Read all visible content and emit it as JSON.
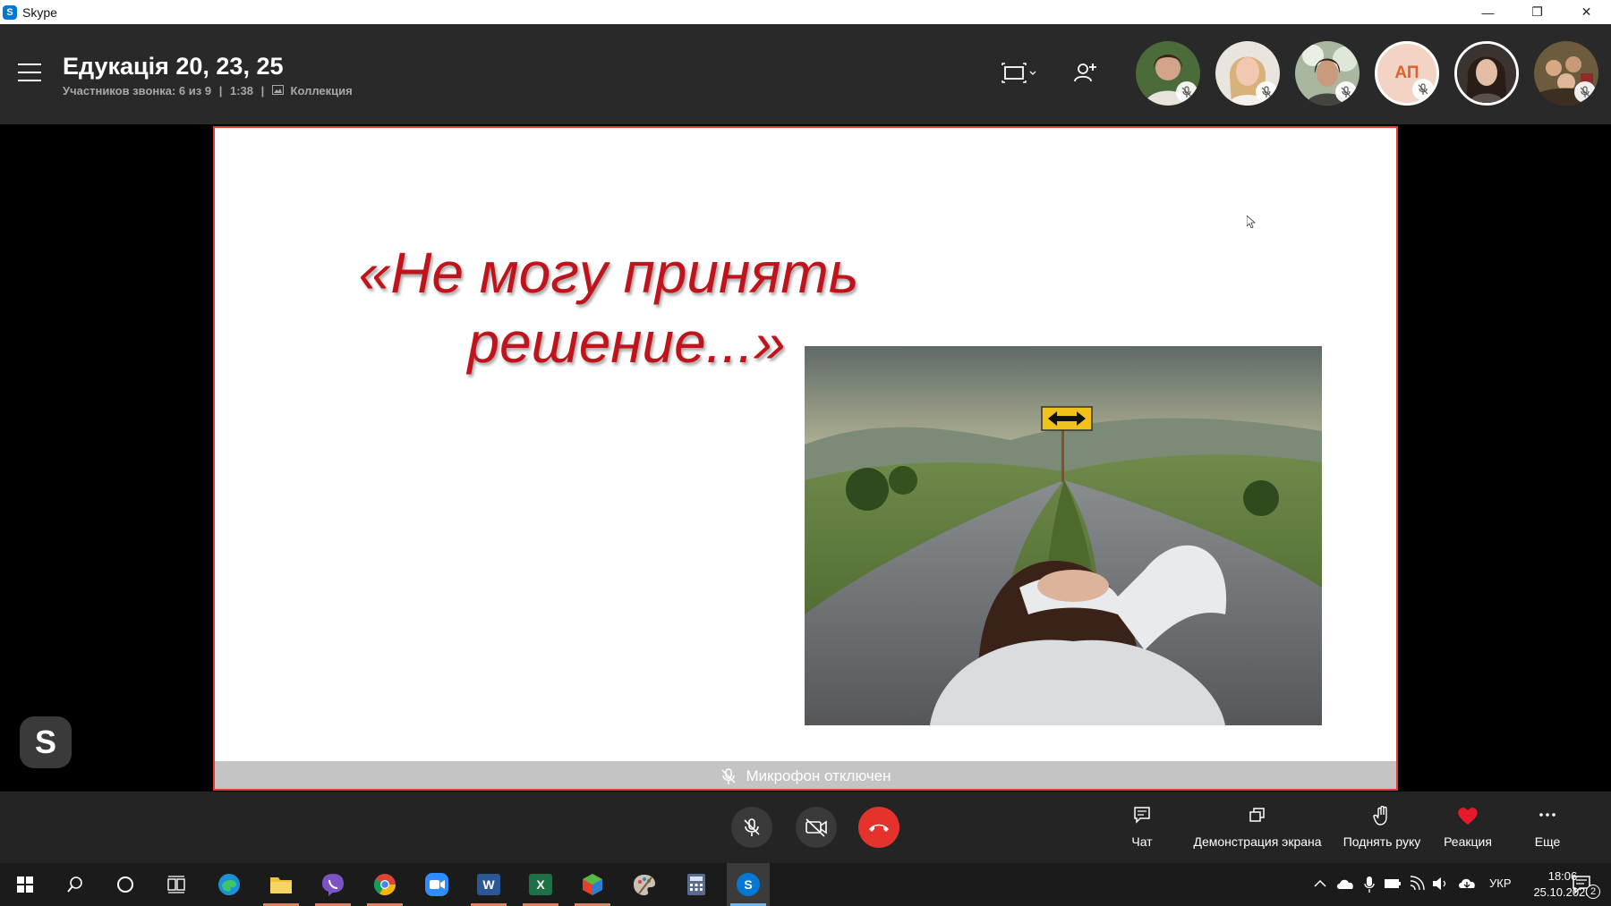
{
  "window": {
    "app_name": "Skype",
    "logo_letter": "S",
    "controls": {
      "minimize": "—",
      "restore": "❐",
      "close": "✕"
    }
  },
  "call": {
    "title": "Едукація 20, 23, 25",
    "participants_text": "Участников звонка: 6 из 9",
    "duration": "1:38",
    "separator": "|",
    "collection_label": "Коллекция"
  },
  "participants": [
    {
      "name": "participant-1",
      "muted": true
    },
    {
      "name": "participant-2",
      "muted": true
    },
    {
      "name": "participant-3",
      "muted": true
    },
    {
      "name": "participant-4",
      "initials": "АП",
      "muted": true
    },
    {
      "name": "participant-5",
      "muted": false,
      "active_speaker": true
    },
    {
      "name": "participant-6",
      "muted": true
    }
  ],
  "slide": {
    "title_line1": "«Не могу принять",
    "title_line2": "решение...»",
    "photo_icon": "crossroads-photo"
  },
  "mic_status": "Микрофон отключен",
  "controls": {
    "chat_label": "Чат",
    "share_label": "Демонстрация экрана",
    "raise_hand_label": "Поднять руку",
    "reaction_label": "Реакция",
    "more_label": "Еще",
    "reaction_color": "#e8192c",
    "end_call_color": "#e5322d"
  },
  "taskbar": {
    "apps": [
      "start",
      "search",
      "cortana",
      "task-view",
      "edge",
      "file-explorer",
      "viber",
      "chrome",
      "zoom",
      "word",
      "excel",
      "paint-3d",
      "paint",
      "calculator",
      "skype"
    ],
    "word_letter": "W",
    "excel_letter": "X",
    "skype_letter": "S",
    "language": "УКР",
    "time": "18:06",
    "date": "25.10.2020",
    "notification_count": "2"
  },
  "colors": {
    "header_bg": "#292929",
    "controls_bg": "#242424",
    "slide_border": "#e53935",
    "slide_title": "#c0141c",
    "accent": "#0078d4"
  }
}
